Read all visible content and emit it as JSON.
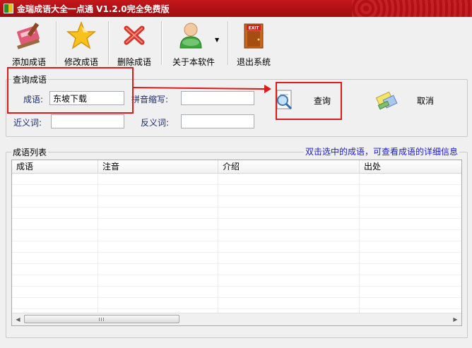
{
  "window": {
    "title": "金瑞成语大全一点通 V1.2.0完全免费版"
  },
  "toolbar": {
    "items": [
      {
        "label": "添加成语",
        "icon": "add-brush-icon"
      },
      {
        "label": "修改成语",
        "icon": "star-edit-icon"
      },
      {
        "label": "删除成语",
        "icon": "delete-x-icon"
      },
      {
        "label": "关于本软件",
        "icon": "user-info-icon"
      },
      {
        "label": "退出系统",
        "icon": "exit-door-icon"
      }
    ]
  },
  "query_group": {
    "title": "查询成语",
    "idiom_label": "成语:",
    "idiom_value": "东坡下载",
    "pinyin_label": "拼音缩写:",
    "pinyin_value": "",
    "synonym_label": "近义词:",
    "synonym_value": "",
    "antonym_label": "反义词:",
    "antonym_value": "",
    "search_button": "查询",
    "cancel_button": "取消"
  },
  "list_group": {
    "title": "成语列表",
    "hint": "双击选中的成语，可查看成语的详细信息",
    "columns": [
      "成语",
      "注音",
      "介绍",
      "出处"
    ]
  },
  "colors": {
    "title_bar": "#b5131a",
    "highlight_box": "#e01919",
    "hint_text": "#0000cc"
  }
}
